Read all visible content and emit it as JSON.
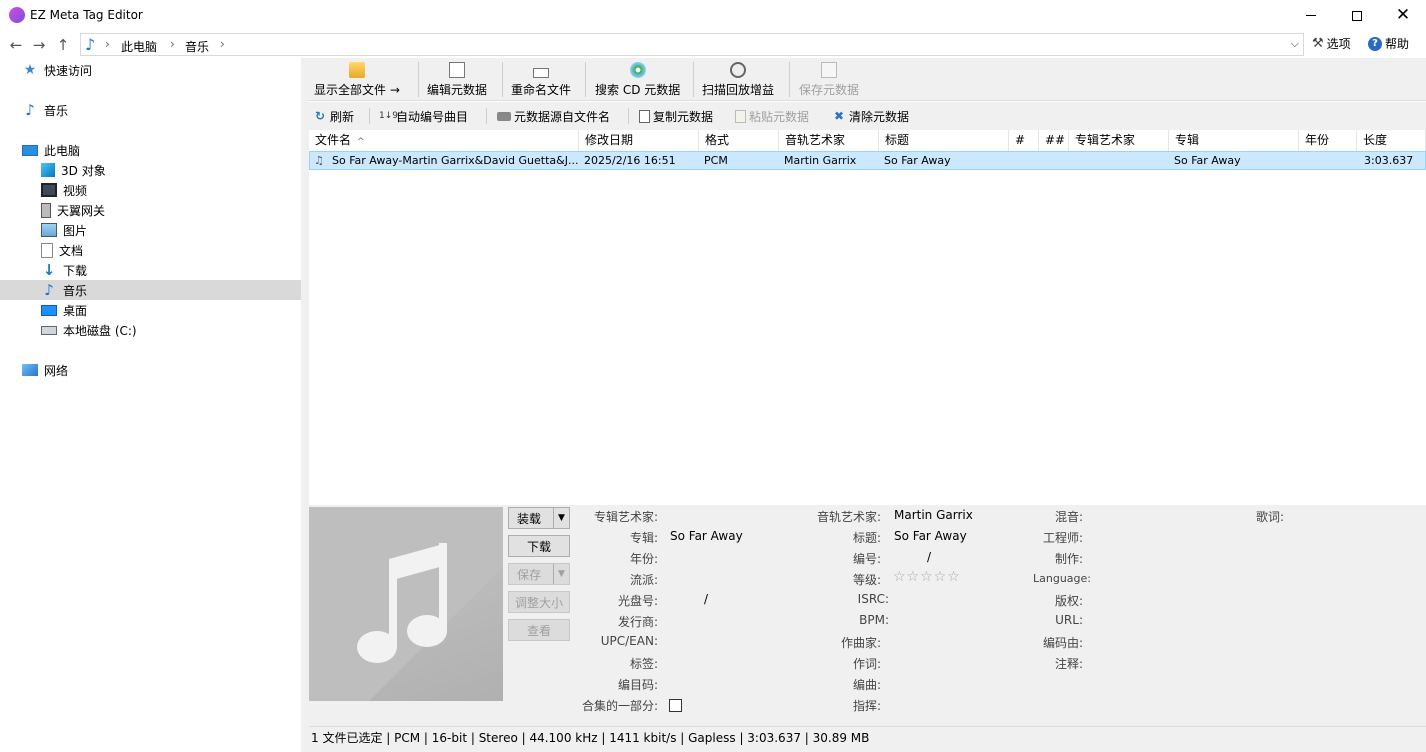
{
  "window": {
    "title": "EZ Meta Tag Editor"
  },
  "address": {
    "crumbs": [
      "此电脑",
      "音乐"
    ]
  },
  "toptools": {
    "options": "选项",
    "help": "帮助"
  },
  "sidebar": {
    "items": [
      {
        "label": "快速访问"
      },
      {
        "label": "音乐"
      },
      {
        "label": "此电脑"
      },
      {
        "label": "3D 对象"
      },
      {
        "label": "视频"
      },
      {
        "label": "天翼网关"
      },
      {
        "label": "图片"
      },
      {
        "label": "文档"
      },
      {
        "label": "下载"
      },
      {
        "label": "音乐"
      },
      {
        "label": "桌面"
      },
      {
        "label": "本地磁盘 (C:)"
      },
      {
        "label": "网络"
      }
    ]
  },
  "ribbon": {
    "show_all": "显示全部文件 →",
    "edit_meta": "编辑元数据",
    "rename": "重命名文件",
    "search_cd": "搜索 CD 元数据",
    "scan_gain": "扫描回放增益",
    "save_meta": "保存元数据"
  },
  "toolbar": {
    "refresh": "刷新",
    "auto_number": "自动编号曲目",
    "meta_from_name": "元数据源自文件名",
    "copy_meta": "复制元数据",
    "paste_meta": "粘贴元数据",
    "clear_meta": "清除元数据"
  },
  "table": {
    "columns": [
      "文件名",
      "修改日期",
      "格式",
      "音轨艺术家",
      "标题",
      "#",
      "##",
      "专辑艺术家",
      "专辑",
      "年份",
      "长度"
    ],
    "rows": [
      {
        "filename": "So Far Away-Martin Garrix&David Guetta&J...",
        "date": "2025/2/16 16:51",
        "format": "PCM",
        "artist": "Martin Garrix",
        "title": "So Far Away",
        "track": "",
        "disc": "",
        "album_artist": "",
        "album": "So Far Away",
        "year": "",
        "length": "3:03.637"
      }
    ]
  },
  "art_buttons": {
    "load": "装载",
    "download": "下载",
    "save": "保存",
    "resize": "调整大小",
    "view": "查看"
  },
  "fields": {
    "col1": [
      {
        "label": "专辑艺术家:",
        "value": ""
      },
      {
        "label": "专辑:",
        "value": "So Far Away"
      },
      {
        "label": "年份:",
        "value": ""
      },
      {
        "label": "流派:",
        "value": ""
      },
      {
        "label": "光盘号:",
        "value": "/"
      },
      {
        "label": "发行商:",
        "value": ""
      },
      {
        "label": "UPC/EAN:",
        "value": ""
      },
      {
        "label": "标签:",
        "value": ""
      },
      {
        "label": "编目码:",
        "value": ""
      },
      {
        "label": "合集的一部分:",
        "value": ""
      }
    ],
    "col2": [
      {
        "label": "音轨艺术家:",
        "value": "Martin Garrix"
      },
      {
        "label": "标题:",
        "value": "So Far Away"
      },
      {
        "label": "编号:",
        "value": "/"
      },
      {
        "label": "等级:",
        "value": "☆☆☆☆☆"
      },
      {
        "label": "ISRC:",
        "value": ""
      },
      {
        "label": "BPM:",
        "value": ""
      },
      {
        "label": "作曲家:",
        "value": ""
      },
      {
        "label": "作词:",
        "value": ""
      },
      {
        "label": "编曲:",
        "value": ""
      },
      {
        "label": "指挥:",
        "value": ""
      }
    ],
    "col3": [
      {
        "label": "混音:"
      },
      {
        "label": "工程师:"
      },
      {
        "label": "制作:"
      },
      {
        "label": "Language:"
      },
      {
        "label": "版权:"
      },
      {
        "label": "URL:"
      },
      {
        "label": "编码由:"
      },
      {
        "label": "注释:"
      }
    ],
    "lyrics_label": "歌词:"
  },
  "status": {
    "text": "1 文件已选定 | PCM | 16-bit | Stereo | 44.100 kHz | 1411 kbit/s | Gapless | 3:03.637 | 30.89 MB"
  }
}
